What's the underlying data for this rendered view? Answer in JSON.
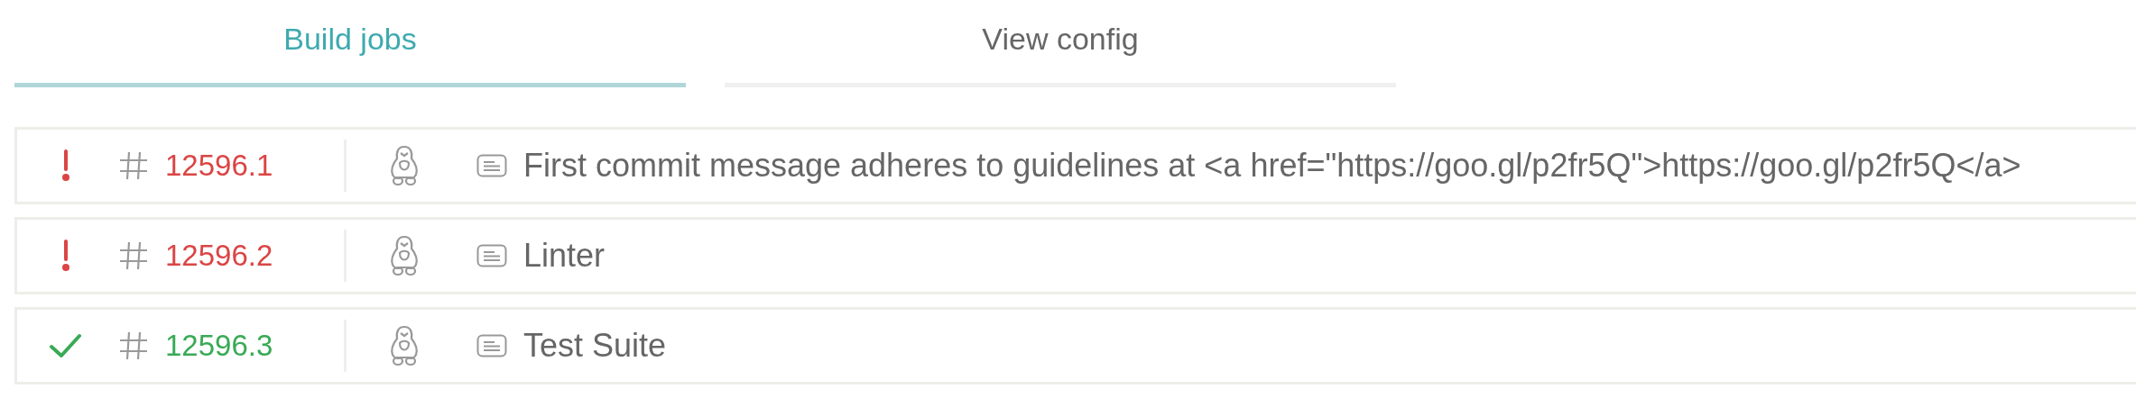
{
  "tabs": [
    {
      "label": "Build jobs",
      "selected": true
    },
    {
      "label": "View config",
      "selected": false
    }
  ],
  "jobs": [
    {
      "kind": "failed",
      "number": "12596.1",
      "message": "First commit message adheres to guidelines at <a href=\"https://goo.gl/p2fr5Q\">https://goo.gl/p2fr5Q</a>"
    },
    {
      "kind": "failed",
      "number": "12596.2",
      "message": "Linter"
    },
    {
      "kind": "passed",
      "number": "12596.3",
      "message": "Test Suite"
    }
  ]
}
